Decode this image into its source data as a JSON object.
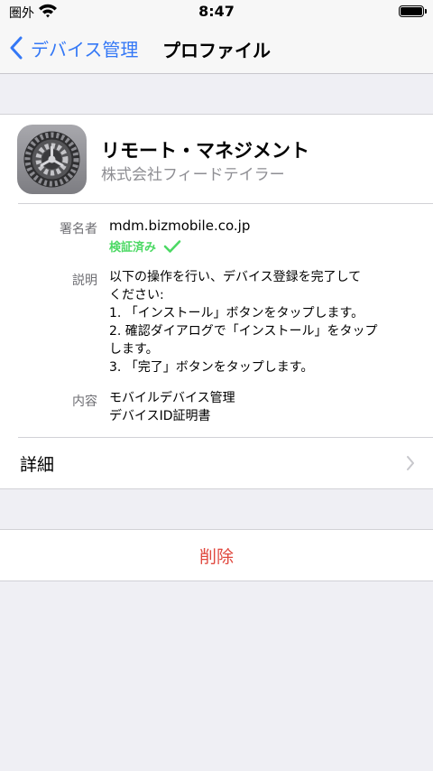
{
  "status_bar": {
    "carrier": "圏外",
    "time": "8:47"
  },
  "nav": {
    "back_label": "デバイス管理",
    "title": "プロファイル"
  },
  "profile": {
    "name": "リモート・マネジメント",
    "organization": "株式会社フィードテイラー",
    "signer_label": "署名者",
    "signer_value": "mdm.bizmobile.co.jp",
    "verified_label": "検証済み",
    "description_label": "説明",
    "description_lines": [
      "以下の操作を行い、デバイス登録を完了して",
      "ください:",
      "1. 「インストール」ボタンをタップします。",
      "2. 確認ダイアログで「インストール」をタップ",
      "します。",
      "3. 「完了」ボタンをタップします。"
    ],
    "contents_label": "内容",
    "contents_lines": [
      "モバイルデバイス管理",
      "デバイスID証明書"
    ]
  },
  "details": {
    "label": "詳細"
  },
  "delete": {
    "label": "削除"
  },
  "colors": {
    "accent": "#3478f6",
    "verified": "#4cd964",
    "destructive": "#e0483e",
    "background": "#efeff4"
  },
  "icons": [
    "wifi-icon",
    "battery-icon",
    "chevron-left-icon",
    "settings-gear-icon",
    "checkmark-icon",
    "chevron-right-icon"
  ]
}
